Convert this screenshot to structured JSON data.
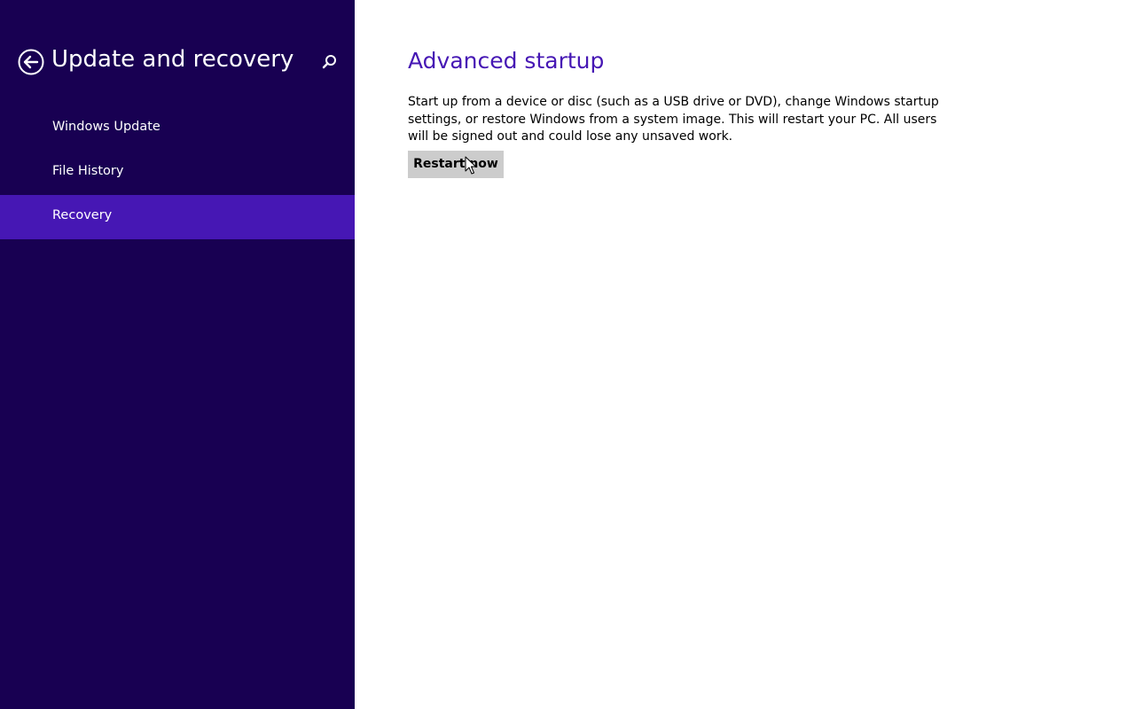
{
  "sidebar": {
    "title": "Update and recovery",
    "back_icon": "back-arrow-circle-icon",
    "search_icon": "search-icon",
    "items": [
      {
        "label": "Windows Update",
        "selected": false
      },
      {
        "label": "File History",
        "selected": false
      },
      {
        "label": "Recovery",
        "selected": true
      }
    ]
  },
  "main": {
    "section_title": "Advanced startup",
    "description": "Start up from a device or disc (such as a USB drive or DVD), change Windows startup settings, or restore Windows from a system image. This will restart your PC. All users will be signed out and could lose any unsaved work.",
    "restart_label": "Restart now"
  },
  "colors": {
    "sidebar_bg": "#180052",
    "selected_bg": "#4617b4",
    "accent": "#4617b4",
    "main_bg": "#ffffff",
    "button_bg": "#cccccc"
  }
}
